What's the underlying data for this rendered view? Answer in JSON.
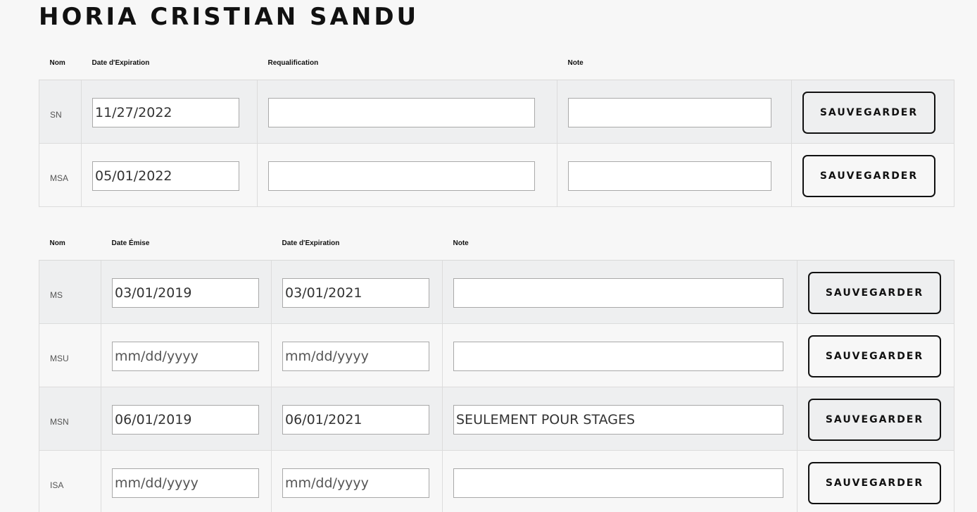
{
  "title": "HORIA CRISTIAN SANDU",
  "table1": {
    "headers": [
      "Nom",
      "Date d'Expiration",
      "Requalification",
      "Note"
    ],
    "rows": [
      {
        "name": "SN",
        "expiration": "11/27/2022",
        "requalification": "",
        "note": "",
        "button": "SAUVEGARDER"
      },
      {
        "name": "MSA",
        "expiration": "05/01/2022",
        "requalification": "",
        "note": "",
        "button": "SAUVEGARDER"
      }
    ]
  },
  "table2": {
    "headers": [
      "Nom",
      "Date Émise",
      "Date d'Expiration",
      "Note"
    ],
    "placeholder": "mm/dd/yyyy",
    "rows": [
      {
        "name": "MS",
        "issued": "03/01/2019",
        "expiration": "03/01/2021",
        "note": "",
        "button": "SAUVEGARDER"
      },
      {
        "name": "MSU",
        "issued": "",
        "expiration": "",
        "note": "",
        "button": "SAUVEGARDER"
      },
      {
        "name": "MSN",
        "issued": "06/01/2019",
        "expiration": "06/01/2021",
        "note": "SEULEMENT POUR STAGES",
        "button": "SAUVEGARDER"
      },
      {
        "name": "ISA",
        "issued": "",
        "expiration": "",
        "note": "",
        "button": "SAUVEGARDER"
      }
    ]
  }
}
